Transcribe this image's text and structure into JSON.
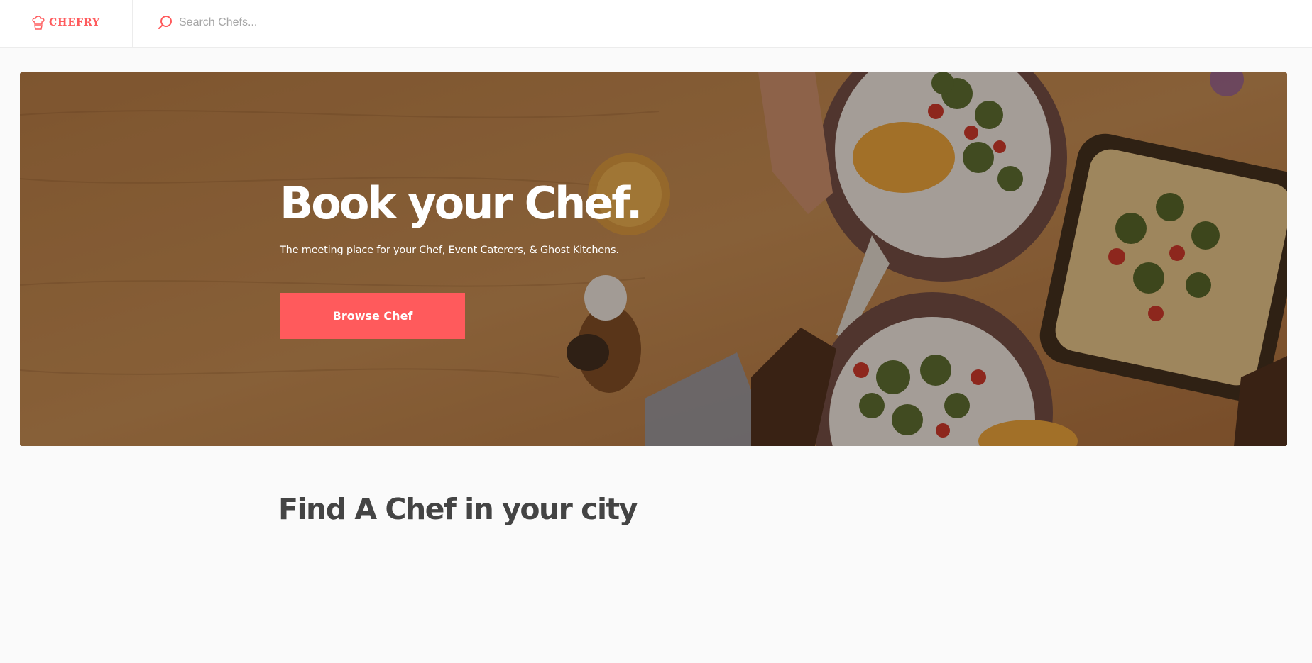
{
  "app": {
    "brand": "CHEFRY",
    "brand_color": "#ff5a5c",
    "logo_icon": "chef-hat-icon"
  },
  "search": {
    "placeholder": "Search Chefs...",
    "value": "",
    "icon": "search-icon"
  },
  "hero": {
    "title": "Book your Chef.",
    "subtitle": "The meeting place for your Chef, Event Caterers, & Ghost Kitchens.",
    "cta_label": "Browse Chef",
    "cta_color": "#ff5a5c"
  },
  "main": {
    "section_title": "Find A Chef in your city"
  }
}
